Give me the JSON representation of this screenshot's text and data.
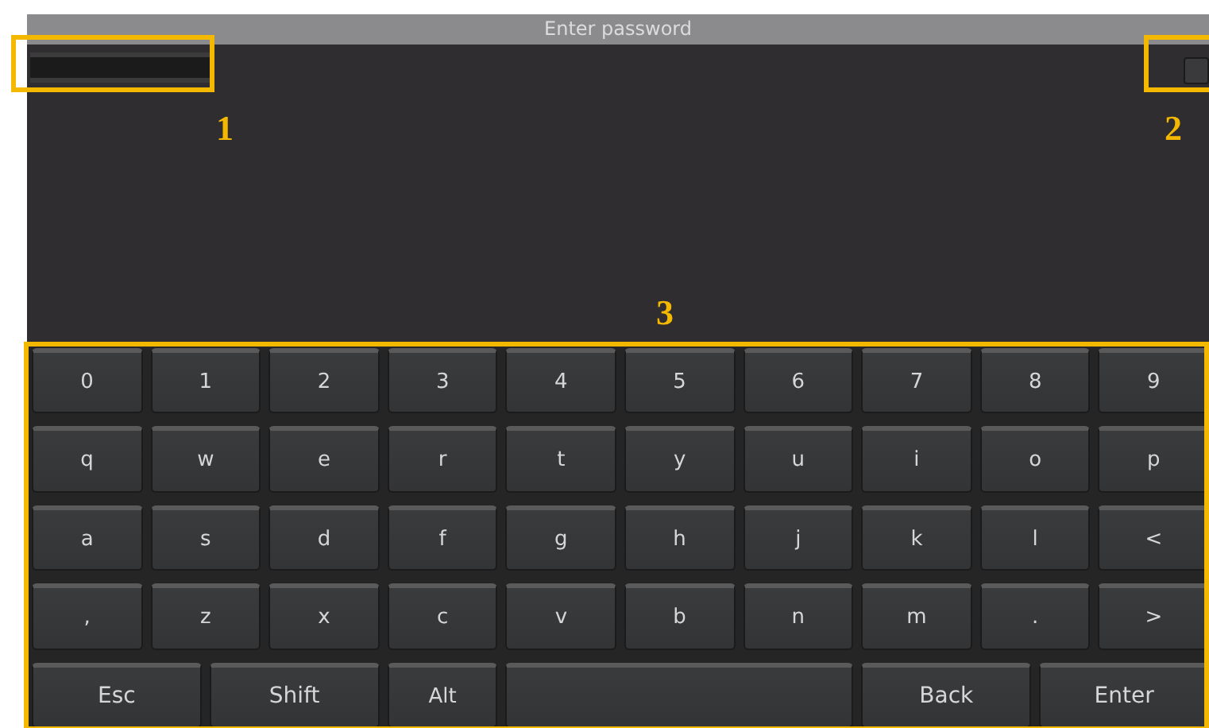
{
  "window": {
    "title": "Enter password"
  },
  "show_toggle": {
    "checked": false
  },
  "annotations": [
    {
      "label": "1"
    },
    {
      "label": "2"
    },
    {
      "label": "3"
    }
  ],
  "keyboard": {
    "rows": [
      [
        {
          "label": "0",
          "kind": "normal"
        },
        {
          "label": "1",
          "kind": "normal"
        },
        {
          "label": "2",
          "kind": "normal"
        },
        {
          "label": "3",
          "kind": "normal"
        },
        {
          "label": "4",
          "kind": "normal"
        },
        {
          "label": "5",
          "kind": "normal"
        },
        {
          "label": "6",
          "kind": "normal"
        },
        {
          "label": "7",
          "kind": "normal"
        },
        {
          "label": "8",
          "kind": "normal"
        },
        {
          "label": "9",
          "kind": "normal"
        }
      ],
      [
        {
          "label": "q",
          "kind": "normal"
        },
        {
          "label": "w",
          "kind": "normal"
        },
        {
          "label": "e",
          "kind": "normal"
        },
        {
          "label": "r",
          "kind": "normal"
        },
        {
          "label": "t",
          "kind": "normal"
        },
        {
          "label": "y",
          "kind": "normal"
        },
        {
          "label": "u",
          "kind": "normal"
        },
        {
          "label": "i",
          "kind": "normal"
        },
        {
          "label": "o",
          "kind": "normal"
        },
        {
          "label": "p",
          "kind": "normal"
        }
      ],
      [
        {
          "label": "a",
          "kind": "normal"
        },
        {
          "label": "s",
          "kind": "normal"
        },
        {
          "label": "d",
          "kind": "normal"
        },
        {
          "label": "f",
          "kind": "normal"
        },
        {
          "label": "g",
          "kind": "normal"
        },
        {
          "label": "h",
          "kind": "normal"
        },
        {
          "label": "j",
          "kind": "normal"
        },
        {
          "label": "k",
          "kind": "normal"
        },
        {
          "label": "l",
          "kind": "normal"
        },
        {
          "label": "<",
          "kind": "normal"
        }
      ],
      [
        {
          "label": ",",
          "kind": "normal"
        },
        {
          "label": "z",
          "kind": "normal"
        },
        {
          "label": "x",
          "kind": "normal"
        },
        {
          "label": "c",
          "kind": "normal"
        },
        {
          "label": "v",
          "kind": "normal"
        },
        {
          "label": "b",
          "kind": "normal"
        },
        {
          "label": "n",
          "kind": "normal"
        },
        {
          "label": "m",
          "kind": "normal"
        },
        {
          "label": ".",
          "kind": "normal"
        },
        {
          "label": ">",
          "kind": "normal"
        }
      ]
    ],
    "bottom_keys": [
      {
        "label": "Esc",
        "kind": "wide"
      },
      {
        "label": "Shift",
        "kind": "wide"
      },
      {
        "label": "Alt",
        "kind": "normal"
      },
      {
        "kind": "space"
      },
      {
        "label": "Back",
        "kind": "wide"
      },
      {
        "label": "Enter",
        "kind": "wide"
      }
    ]
  }
}
